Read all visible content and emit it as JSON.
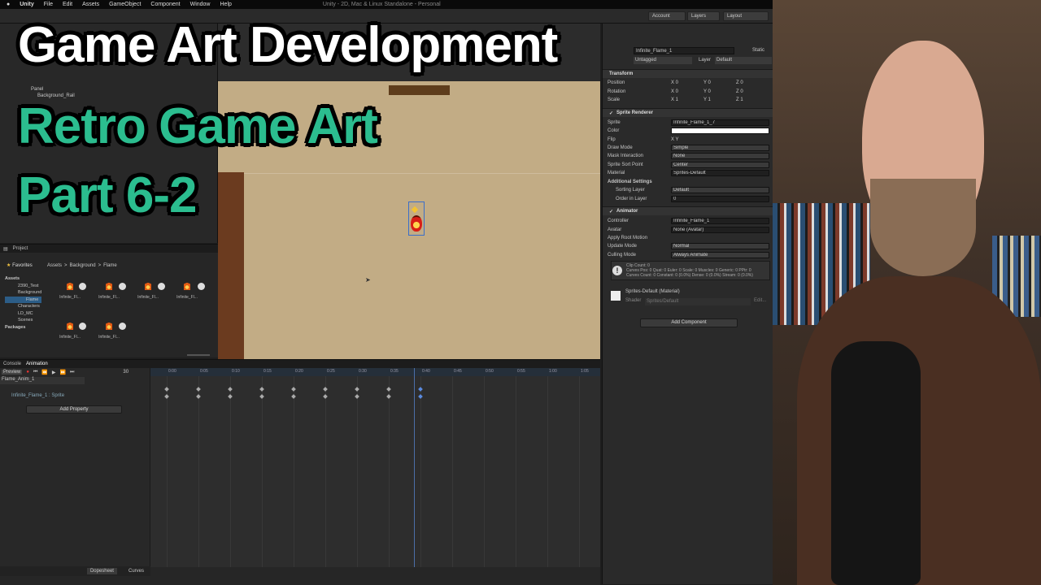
{
  "menubar": {
    "items": [
      "Unity",
      "File",
      "Edit",
      "Assets",
      "GameObject",
      "Component",
      "Window",
      "Help"
    ],
    "window_title": "Unity - 2D, Mac & Linux Standalone - Personal"
  },
  "toolbar": {
    "account": "Account",
    "layers": "Layers",
    "layout": "Layout"
  },
  "overlay": {
    "line1": "Game Art Development",
    "line2": "Retro Game Art",
    "line3": "Part 6-2"
  },
  "hierarchy": {
    "items": [
      "Panel",
      "Background_Rail"
    ]
  },
  "project": {
    "tab": "Project",
    "favorites": "Favorites",
    "breadcrumb": [
      "Assets",
      "Background",
      "Flame"
    ],
    "tree": [
      "Assets",
      "2390_Test",
      "Background",
      "Flame",
      "Characters",
      "LD_MC",
      "Scenes",
      "Packages"
    ],
    "asset_label": "Infinite_Fl..."
  },
  "inspector": {
    "object_name": "Infinite_Flame_1",
    "static": "Static",
    "tag": "Untagged",
    "layer_label": "Layer",
    "layer": "Default",
    "transform": {
      "header": "Transform",
      "rows": [
        {
          "label": "Position",
          "x": "X 0",
          "y": "Y 0",
          "z": "Z 0"
        },
        {
          "label": "Rotation",
          "x": "X 0",
          "y": "Y 0",
          "z": "Z 0"
        },
        {
          "label": "Scale",
          "x": "X 1",
          "y": "Y 1",
          "z": "Z 1"
        }
      ]
    },
    "sprite_renderer": {
      "header": "Sprite Renderer",
      "rows": [
        {
          "label": "Sprite",
          "value": "Infinite_Flame_1_7"
        },
        {
          "label": "Color",
          "value": ""
        },
        {
          "label": "Flip",
          "value": "X   Y"
        },
        {
          "label": "Draw Mode",
          "value": "Simple"
        },
        {
          "label": "Mask Interaction",
          "value": "None"
        },
        {
          "label": "Sprite Sort Point",
          "value": "Center"
        },
        {
          "label": "Material",
          "value": "Sprites-Default"
        }
      ],
      "additional": "Additional Settings",
      "sorting_layer": {
        "label": "Sorting Layer",
        "value": "Default"
      },
      "order": {
        "label": "Order in Layer",
        "value": "0"
      }
    },
    "animator": {
      "header": "Animator",
      "rows": [
        {
          "label": "Controller",
          "value": "Infinite_Flame_1"
        },
        {
          "label": "Avatar",
          "value": "None (Avatar)"
        },
        {
          "label": "Apply Root Motion",
          "value": ""
        },
        {
          "label": "Update Mode",
          "value": "Normal"
        },
        {
          "label": "Culling Mode",
          "value": "Always Animate"
        }
      ],
      "info": "Clip Count: 0\nCurves Pos: 0 Quat: 0 Euler: 0 Scale: 0 Muscles: 0 Generic: 0 PPtr: 0\nCurves Count: 0 Constant: 0 (0.0%) Dense: 0 (0.0%) Stream: 0 (0.0%)"
    },
    "material": {
      "name": "Sprites-Default (Material)",
      "shader_label": "Shader",
      "shader": "Sprites/Default",
      "edit": "Edit..."
    },
    "add_component": "Add Component"
  },
  "animation": {
    "tabs": [
      "Console",
      "Animation"
    ],
    "preview": "Preview",
    "frame": "30",
    "clip": "Flame_Anim_1",
    "property": "Infinite_Flame_1 : Sprite",
    "add_property": "Add Property",
    "ticks": [
      "0:00",
      "0:05",
      "0:10",
      "0:15",
      "0:20",
      "0:25",
      "0:30",
      "0:35",
      "0:40",
      "0:45",
      "0:50",
      "0:55",
      "1:00",
      "1:05"
    ],
    "bottom_tabs": [
      "Dopesheet",
      "Curves"
    ]
  },
  "colors": {
    "accent_green": "#2bbd8f",
    "scene_floor": "#c2ac85",
    "wood": "#6b3b1f"
  }
}
